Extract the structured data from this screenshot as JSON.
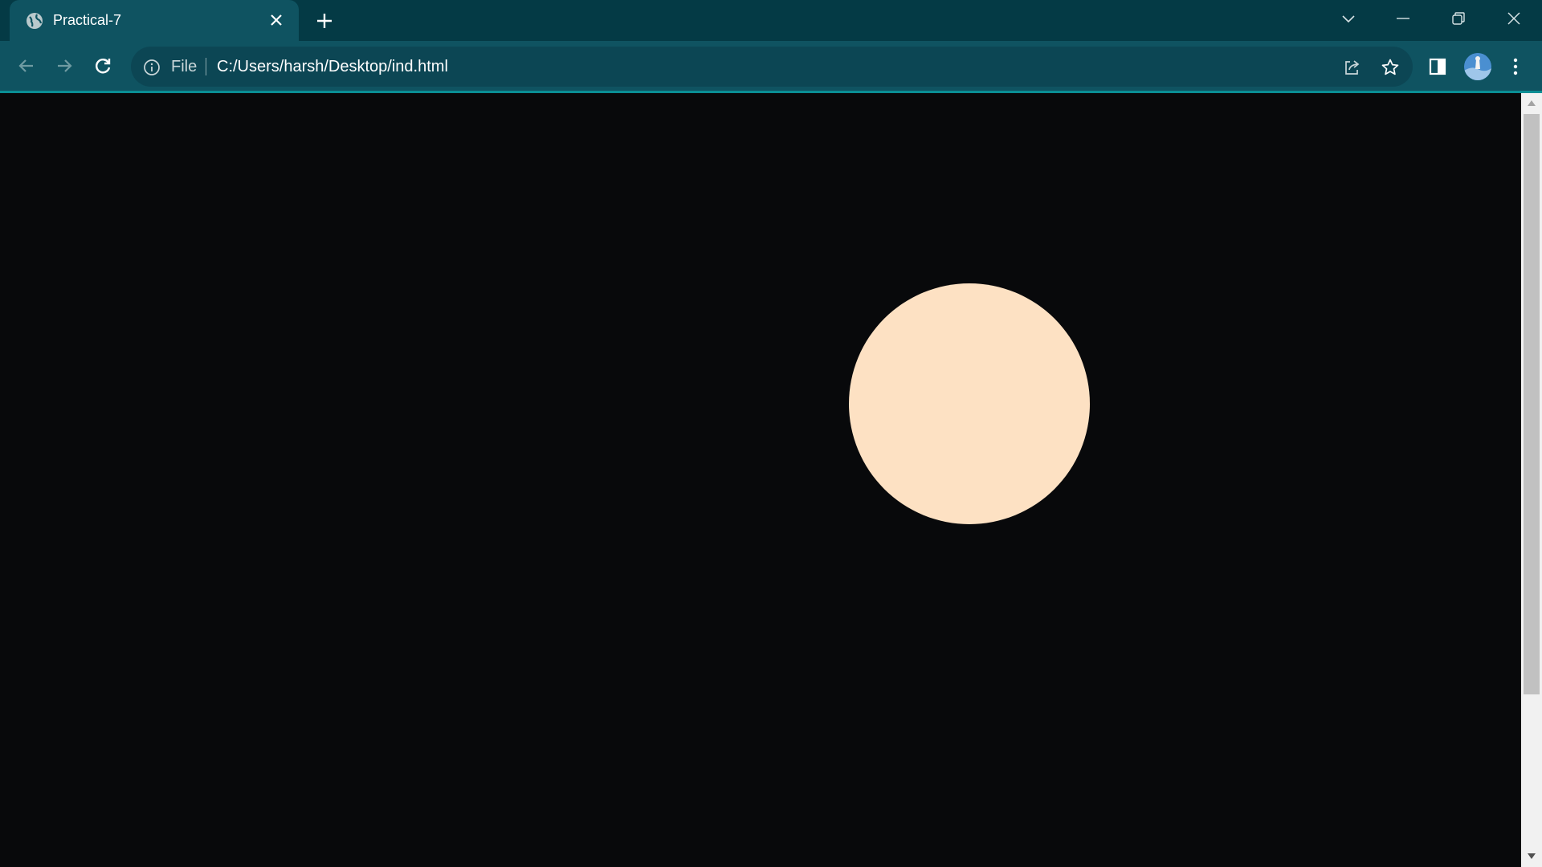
{
  "browser": {
    "tab": {
      "title": "Practical-7"
    },
    "omnibox": {
      "scheme_label": "File",
      "url": "C:/Users/harsh/Desktop/ind.html"
    },
    "colors": {
      "titlebar": "#043a45",
      "toolbar": "#0f5361",
      "accent": "#0a8e95"
    }
  },
  "page": {
    "background": "#08090b",
    "circle": {
      "color": "#fde1c3"
    }
  },
  "icons": {
    "tab_favicon": "globe-icon",
    "tab_close": "close-icon",
    "new_tab": "plus-icon",
    "tab_search": "chevron-down-icon",
    "minimize": "minimize-icon",
    "restore": "restore-icon",
    "close_window": "close-icon",
    "back": "arrow-left-icon",
    "forward": "arrow-right-icon",
    "reload": "reload-icon",
    "site_info": "info-icon",
    "share": "share-icon",
    "bookmark": "star-icon",
    "side_panel": "side-panel-icon",
    "profile": "avatar",
    "menu": "kebab-menu-icon"
  }
}
